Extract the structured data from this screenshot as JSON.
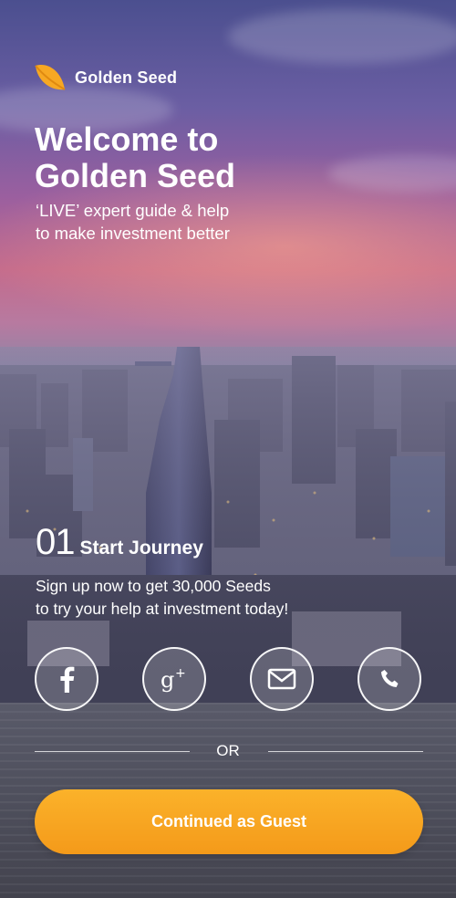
{
  "brand": {
    "name": "Golden Seed",
    "logo_icon": "leaf-logo-icon",
    "accent": "#F7A823"
  },
  "hero": {
    "title_line1": "Welcome to",
    "title_line2": "Golden Seed",
    "subtitle_line1": "‘LIVE’ expert guide & help",
    "subtitle_line2": "to make investment better"
  },
  "step": {
    "number": "01",
    "label": "Start Journey",
    "desc_line1": "Sign up now to get 30,000 Seeds",
    "desc_line2": "to try your help at investment today!"
  },
  "social": [
    {
      "name": "facebook",
      "icon": "facebook-icon"
    },
    {
      "name": "google-plus",
      "icon": "google-plus-icon"
    },
    {
      "name": "email",
      "icon": "mail-icon"
    },
    {
      "name": "phone",
      "icon": "phone-icon"
    }
  ],
  "divider": {
    "or_label": "OR"
  },
  "guest_button": {
    "label": "Continued as Guest"
  }
}
